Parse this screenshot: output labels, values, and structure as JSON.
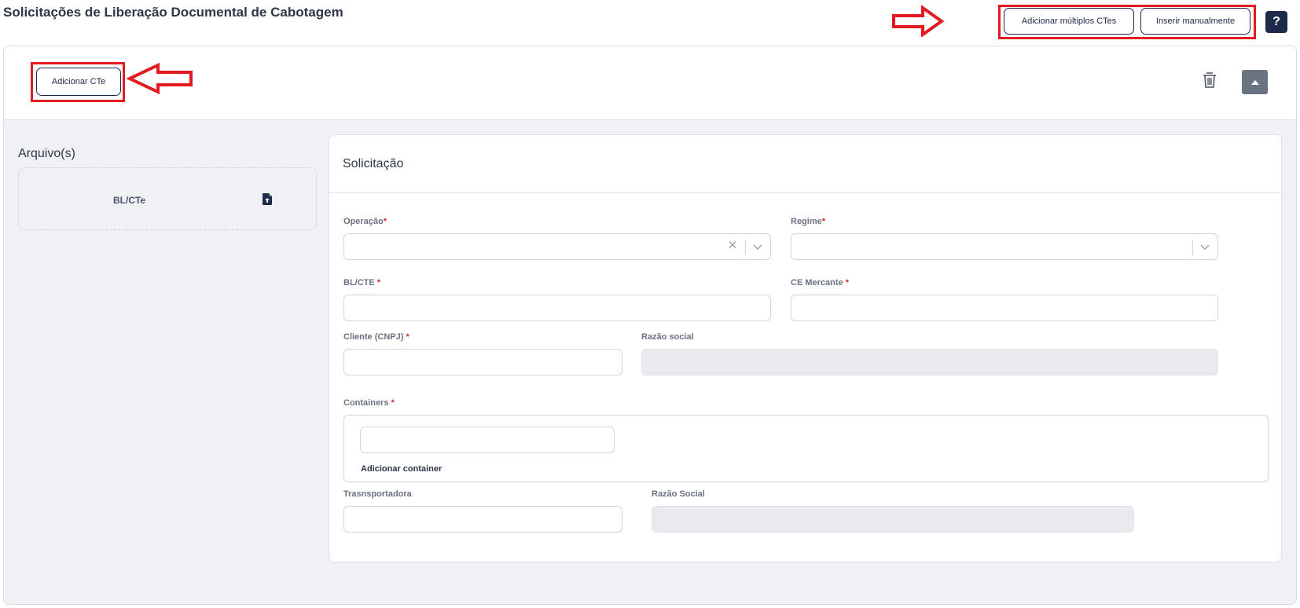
{
  "page": {
    "title": "Solicitações de Liberação Documental de Cabotagem"
  },
  "top_actions": {
    "add_multiple_label": "Adicionar múltiplos CTes",
    "insert_manual_label": "Inserir manualmente",
    "help_label": "?"
  },
  "card": {
    "add_cte_label": "Adicionar CTe",
    "delete_icon": "trash-icon",
    "collapse_icon": "caret-up-icon"
  },
  "files": {
    "title": "Arquivo(s)",
    "items": [
      {
        "label": "BL/CTe",
        "icon": "file-upload-icon"
      }
    ]
  },
  "form": {
    "title": "Solicitação",
    "operacao": {
      "label": "Operação",
      "value": ""
    },
    "regime": {
      "label": "Regime",
      "value": ""
    },
    "bl_cte": {
      "label": "BL/CTE ",
      "value": ""
    },
    "ce_mercante": {
      "label": "CE Mercante ",
      "value": ""
    },
    "cliente": {
      "label": "Cliente (CNPJ) ",
      "value": ""
    },
    "razao_social": {
      "label": "Razão social",
      "value": ""
    },
    "containers": {
      "label": "Containers ",
      "value": "",
      "add_label": "Adicionar container"
    },
    "transportadora": {
      "label": "Trasnsportadora",
      "value": ""
    },
    "razao_social_transp": {
      "label": "Razão Social",
      "value": ""
    },
    "required_mark": "*"
  },
  "colors": {
    "annotation_red": "#e21b23",
    "navy": "#1e2a4a",
    "required": "#d62828"
  }
}
